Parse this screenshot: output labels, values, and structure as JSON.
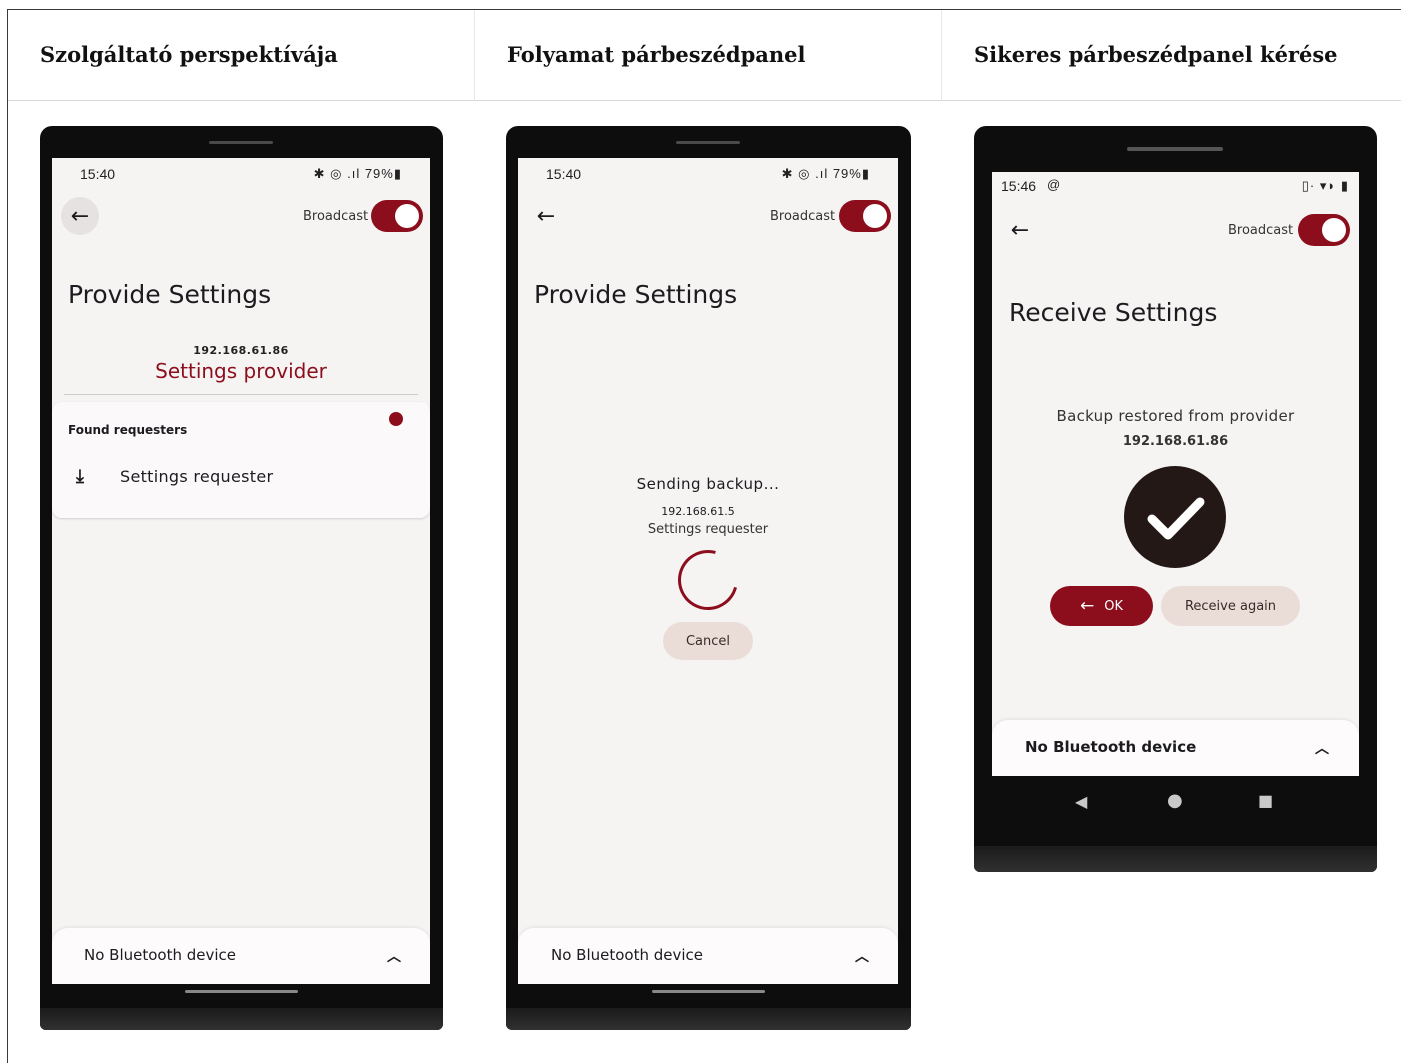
{
  "columns": [
    {
      "title": "Szolgáltató perspektívája"
    },
    {
      "title": "Folyamat párbeszédpanel"
    },
    {
      "title": "Sikeres párbeszédpanel kérése"
    }
  ],
  "phone1": {
    "time": "15:40",
    "status_icons": "✱ ◎ .ıl 79%▮",
    "broadcast_label": "Broadcast",
    "broadcast_on": true,
    "title": "Provide Settings",
    "provider_ip": "192.168.61.86",
    "provider_name": "Settings provider",
    "found_label": "Found requesters",
    "requester_label": "Settings requester",
    "bt_label": "No Bluetooth device"
  },
  "phone2": {
    "time": "15:40",
    "status_icons": "✱ ◎ .ıl 79%▮",
    "broadcast_label": "Broadcast",
    "broadcast_on": true,
    "title": "Provide Settings",
    "sending_text": "Sending backup...",
    "target_ip": "192.168.61.5",
    "target_name": "Settings requester",
    "cancel_label": "Cancel",
    "bt_label": "No Bluetooth device"
  },
  "phone3": {
    "time": "15:46",
    "status_icons": "▯· ▾◗ ▮",
    "broadcast_label": "Broadcast",
    "broadcast_on": true,
    "title": "Receive Settings",
    "restored_text": "Backup restored from provider",
    "provider_ip": "192.168.61.86",
    "ok_label": "OK",
    "receive_again_label": "Receive again",
    "bt_label": "No Bluetooth device"
  },
  "colors": {
    "accent": "#8c0e1d",
    "tonal": "#eaddd8",
    "screen_bg": "#f6f3f3"
  }
}
